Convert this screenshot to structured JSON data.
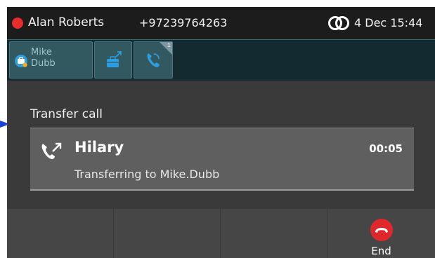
{
  "status_bar": {
    "caller_name": "Alan Roberts",
    "caller_number": "+97239764263",
    "datetime": "4 Dec 15:44",
    "recording_color": "#e82b2b",
    "conference_icon": "conference-icon"
  },
  "dss_keys": [
    {
      "icon": "contact-badge-icon",
      "label_line1": "Mike",
      "label_line2": "Dubb"
    },
    {
      "icon": "briefcase-transfer-icon"
    },
    {
      "icon": "phone-call-icon",
      "badge": "1"
    }
  ],
  "main": {
    "title": "Transfer call",
    "call": {
      "name": "Hilary",
      "duration": "00:05",
      "status": "Transferring to Mike.Dubb",
      "icon": "outgoing-call-icon"
    }
  },
  "softkeys": [
    {
      "label": ""
    },
    {
      "label": ""
    },
    {
      "label": ""
    },
    {
      "label": "End",
      "icon": "end-call-icon",
      "color": "#e0282c"
    }
  ],
  "colors": {
    "accent_teal": "#325860",
    "end_red": "#e0282c",
    "pointer_blue": "#1a3fd6"
  }
}
